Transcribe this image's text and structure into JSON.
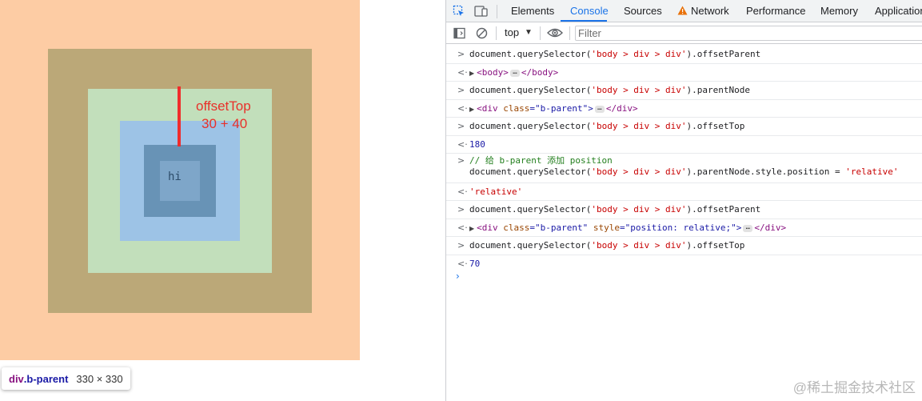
{
  "page": {
    "inner_text": "hi",
    "annotation": {
      "line1": "offsetTop",
      "line2": "30 + 40"
    },
    "tooltip": {
      "tag": "div",
      "class": ".b-parent",
      "size": "330 × 330"
    },
    "colors": {
      "outer": "#fdcca4",
      "parent": "#bba878",
      "green": "#c2dfbb",
      "blue": "#9dc3e6",
      "dark": "#6893b6",
      "inner": "#7ea6c9",
      "annotation": "#e8302a"
    }
  },
  "devtools": {
    "tabs": [
      "Elements",
      "Console",
      "Sources",
      "Network",
      "Performance",
      "Memory",
      "Application"
    ],
    "active_tab": "Console",
    "icons": [
      "inspect-element-icon",
      "device-toggle-icon",
      "sidebar-icon",
      "clear-console-icon",
      "eye-icon",
      "warning-icon"
    ],
    "toolbar": {
      "context": "top",
      "filter_placeholder": "Filter"
    },
    "console": {
      "q1": "'body > div > div'",
      "cmd": "document.querySelector(",
      "r1": {
        "prop": ").offsetParent",
        "tag_open": "<body>",
        "tag_close": "</body>"
      },
      "r2": {
        "prop": ").parentNode",
        "open": "<div ",
        "attr": "class",
        "eq": "=\"b-parent\">",
        "close": "</div>"
      },
      "r3": {
        "prop": ").offsetTop",
        "value": "180"
      },
      "r4": {
        "comment": "// 给 b-parent 添加 position",
        "prop": ").parentNode.style.position = ",
        "assign": "'relative'",
        "value": "'relative'"
      },
      "r5": {
        "prop": ").offsetParent",
        "open": "<div ",
        "attr1": "class",
        "val1": "=\"b-parent\" ",
        "attr2": "style",
        "val2": "=\"position: relative;\">",
        "close": "</div>"
      },
      "r6": {
        "prop": ").offsetTop",
        "value": "70"
      }
    }
  },
  "watermark": "@稀土掘金技术社区"
}
